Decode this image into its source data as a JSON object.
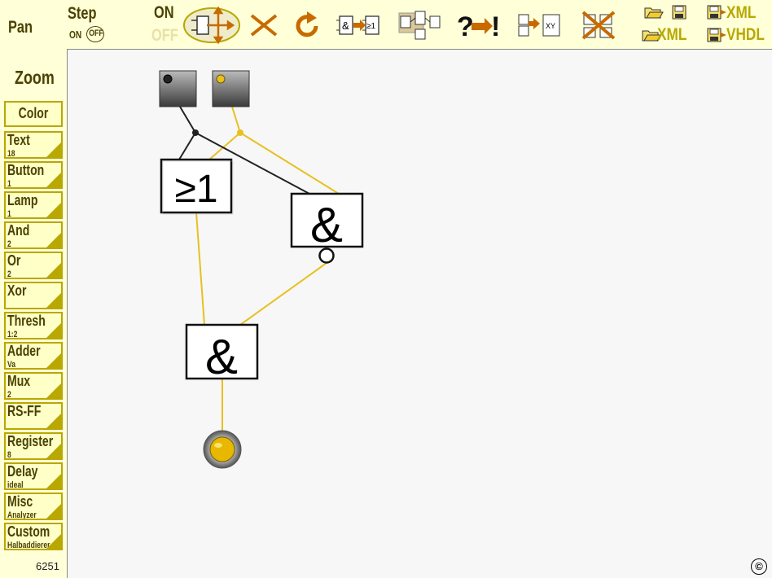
{
  "toolbar": {
    "pan": "Pan",
    "step": "Step",
    "step_on": "ON",
    "step_off": "OFF",
    "sim_on": "ON",
    "sim_off": "OFF",
    "icons": [
      "move-tool-icon",
      "delete-icon",
      "rotate-icon",
      "and-to-or-icon",
      "group-icon",
      "question-to-exclaim-icon",
      "xy-icon",
      "delete-group-icon"
    ],
    "open_xml": "XML",
    "save_xml": "XML",
    "save_vhdl": "VHDL"
  },
  "sidebar": {
    "zoom": "Zoom",
    "color": "Color",
    "items": [
      {
        "label": "Text",
        "sub": "18"
      },
      {
        "label": "Button",
        "sub": "1"
      },
      {
        "label": "Lamp",
        "sub": "1"
      },
      {
        "label": "And",
        "sub": "2"
      },
      {
        "label": "Or",
        "sub": "2"
      },
      {
        "label": "Xor",
        "sub": ""
      },
      {
        "label": "Thresh",
        "sub": "1:2"
      },
      {
        "label": "Adder",
        "sub": "Va"
      },
      {
        "label": "Mux",
        "sub": "2"
      },
      {
        "label": "RS-FF",
        "sub": ""
      },
      {
        "label": "Register",
        "sub": "8"
      },
      {
        "label": "Delay",
        "sub": "ideal"
      },
      {
        "label": "Misc",
        "sub": "Analyzer"
      },
      {
        "label": "Custom",
        "sub": "Halbaddierer"
      }
    ],
    "counter": "6251"
  },
  "canvas": {
    "gates": {
      "or_symbol": "≥1",
      "and1_symbol": "&",
      "and2_symbol": "&"
    },
    "colors": {
      "wire_active": "#e8c020",
      "wire_inactive": "#222222",
      "lamp_on": "#e8b800"
    },
    "copyright": "©"
  }
}
